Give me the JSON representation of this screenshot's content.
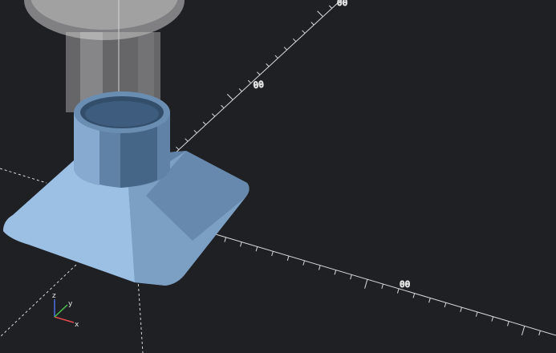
{
  "app": {
    "viewport": "3d-preview"
  },
  "colors": {
    "background": "#1f2024",
    "axis": "#d9d9d9",
    "part_main": "#8fb3d9",
    "part_dark": "#5f82a6",
    "ghost": "#cfcfcf",
    "gizmo_x": "#e04b4b",
    "gizmo_y": "#4bbf4b",
    "gizmo_z": "#4b6fe0"
  },
  "axes": {
    "tick_label_y": "00",
    "tick_label_x": "00",
    "tick_label_top": "00"
  },
  "gizmo": {
    "x": "x",
    "y": "y",
    "z": "z"
  }
}
